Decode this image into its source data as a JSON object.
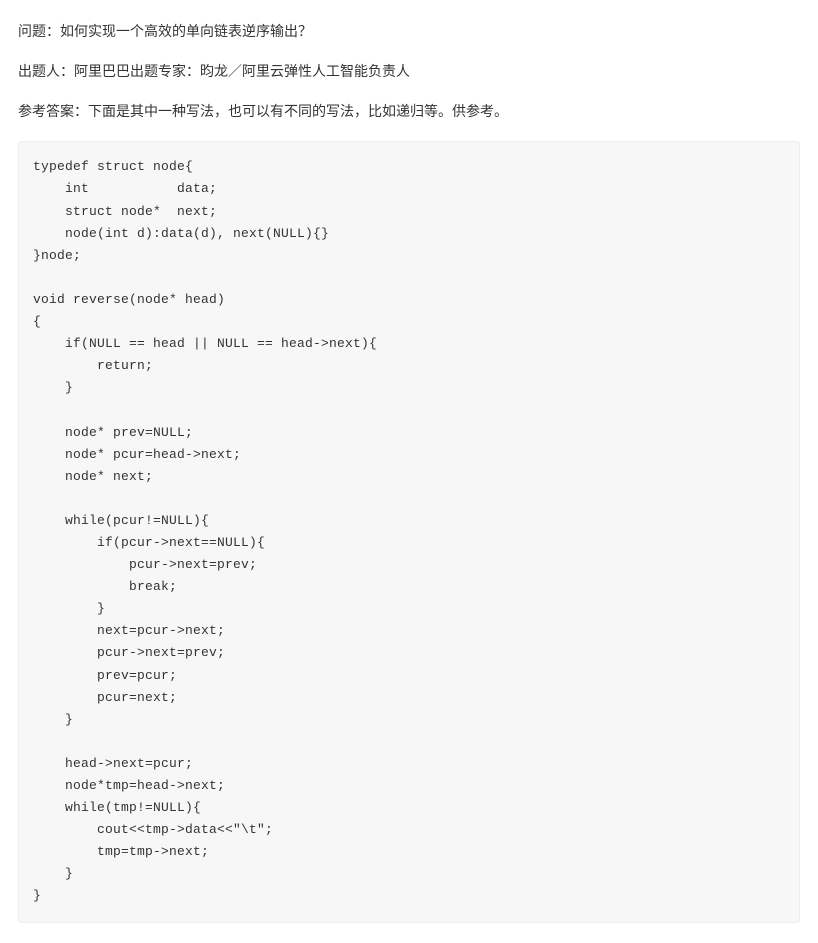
{
  "question": {
    "label": "问题：",
    "text": "如何实现一个高效的单向链表逆序输出？"
  },
  "author": {
    "label": "出题人：",
    "text": "阿里巴巴出题专家：昀龙／阿里云弹性人工智能负责人"
  },
  "answer": {
    "label": "参考答案：",
    "text": "下面是其中一种写法，也可以有不同的写法，比如递归等。供参考。"
  },
  "code": "typedef struct node{\n    int           data;\n    struct node*  next;\n    node(int d):data(d), next(NULL){}\n}node;\n\nvoid reverse(node* head)\n{\n    if(NULL == head || NULL == head->next){\n        return;\n    }\n\n    node* prev=NULL;\n    node* pcur=head->next;\n    node* next;\n\n    while(pcur!=NULL){\n        if(pcur->next==NULL){\n            pcur->next=prev;\n            break;\n        }\n        next=pcur->next;\n        pcur->next=prev;\n        prev=pcur;\n        pcur=next;\n    }\n\n    head->next=pcur;\n    node*tmp=head->next;\n    while(tmp!=NULL){\n        cout<<tmp->data<<\"\\t\";\n        tmp=tmp->next;\n    }\n}"
}
